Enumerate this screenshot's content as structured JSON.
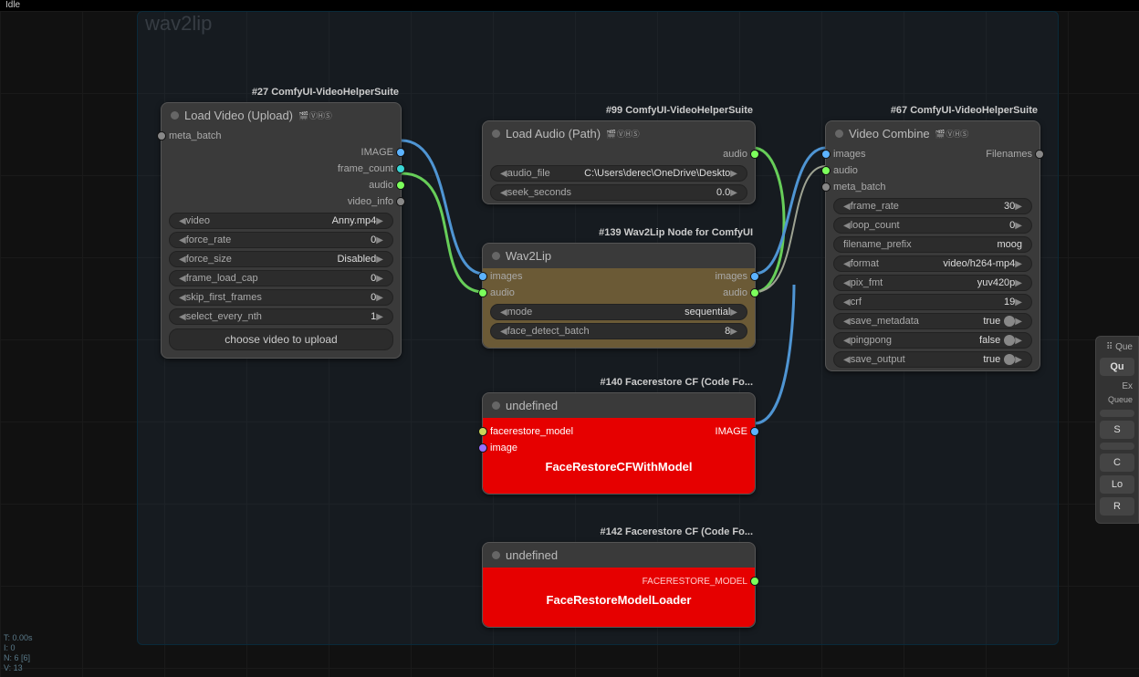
{
  "status_bar": "Idle",
  "group_title": "wav2lip",
  "stats": {
    "l1": "T: 0.00s",
    "l2": "I: 0",
    "l3": "N: 6 [6]",
    "l4": "V: 13"
  },
  "sidebar": {
    "header": "⠿  Que",
    "queue": "Qu",
    "extra": "Ex",
    "queue_lbl": "Queue",
    "btns": [
      "",
      "S",
      "",
      "C",
      "Lo",
      "R"
    ]
  },
  "nodes": {
    "loadvideo": {
      "tag": "#27 ComfyUI-VideoHelperSuite",
      "title": "Load Video (Upload)",
      "badge": "🎬 ⓋⒽⓈ",
      "in": [
        {
          "label": "meta_batch"
        }
      ],
      "out": [
        {
          "label": "IMAGE"
        },
        {
          "label": "frame_count"
        },
        {
          "label": "audio"
        },
        {
          "label": "video_info"
        }
      ],
      "params": [
        {
          "k": "video",
          "v": "Anny.mp4"
        },
        {
          "k": "force_rate",
          "v": "0"
        },
        {
          "k": "force_size",
          "v": "Disabled"
        },
        {
          "k": "frame_load_cap",
          "v": "0"
        },
        {
          "k": "skip_first_frames",
          "v": "0"
        },
        {
          "k": "select_every_nth",
          "v": "1"
        }
      ],
      "button": "choose video to upload"
    },
    "loadaudio": {
      "tag": "#99 ComfyUI-VideoHelperSuite",
      "title": "Load Audio (Path)",
      "badge": "🎬 ⓋⒽⓈ",
      "out": [
        {
          "label": "audio"
        }
      ],
      "params": [
        {
          "k": "audio_file",
          "v": "C:\\Users\\derec\\OneDrive\\Deskto"
        },
        {
          "k": "seek_seconds",
          "v": "0.0"
        }
      ]
    },
    "wav2lip": {
      "tag": "#139 Wav2Lip Node for ComfyUI",
      "title": "Wav2Lip",
      "in": [
        {
          "label": "images"
        },
        {
          "label": "audio"
        }
      ],
      "out": [
        {
          "label": "images"
        },
        {
          "label": "audio"
        }
      ],
      "params": [
        {
          "k": "mode",
          "v": "sequential"
        },
        {
          "k": "face_detect_batch",
          "v": "8"
        }
      ]
    },
    "facerestore": {
      "tag": "#140 Facerestore CF (Code Fo...",
      "title": "undefined",
      "in": [
        {
          "label": "facerestore_model"
        },
        {
          "label": "image"
        }
      ],
      "out": [
        {
          "label": "IMAGE"
        }
      ],
      "big": "FaceRestoreCFWithModel"
    },
    "faceloader": {
      "tag": "#142 Facerestore CF (Code Fo...",
      "title": "undefined",
      "out": [
        {
          "label": "FACERESTORE_MODEL"
        }
      ],
      "big": "FaceRestoreModelLoader"
    },
    "combine": {
      "tag": "#67 ComfyUI-VideoHelperSuite",
      "title": "Video Combine",
      "badge": "🎬 ⓋⒽⓈ",
      "in": [
        {
          "label": "images"
        },
        {
          "label": "audio"
        },
        {
          "label": "meta_batch"
        }
      ],
      "out": [
        {
          "label": "Filenames"
        }
      ],
      "params": [
        {
          "k": "frame_rate",
          "v": "30"
        },
        {
          "k": "loop_count",
          "v": "0"
        },
        {
          "k": "filename_prefix",
          "v": "moog",
          "noarrow": true
        },
        {
          "k": "format",
          "v": "video/h264-mp4"
        },
        {
          "k": "pix_fmt",
          "v": "yuv420p"
        },
        {
          "k": "crf",
          "v": "19"
        },
        {
          "k": "save_metadata",
          "v": "true",
          "toggle": true
        },
        {
          "k": "pingpong",
          "v": "false",
          "toggle": true
        },
        {
          "k": "save_output",
          "v": "true",
          "toggle": true
        }
      ]
    }
  }
}
